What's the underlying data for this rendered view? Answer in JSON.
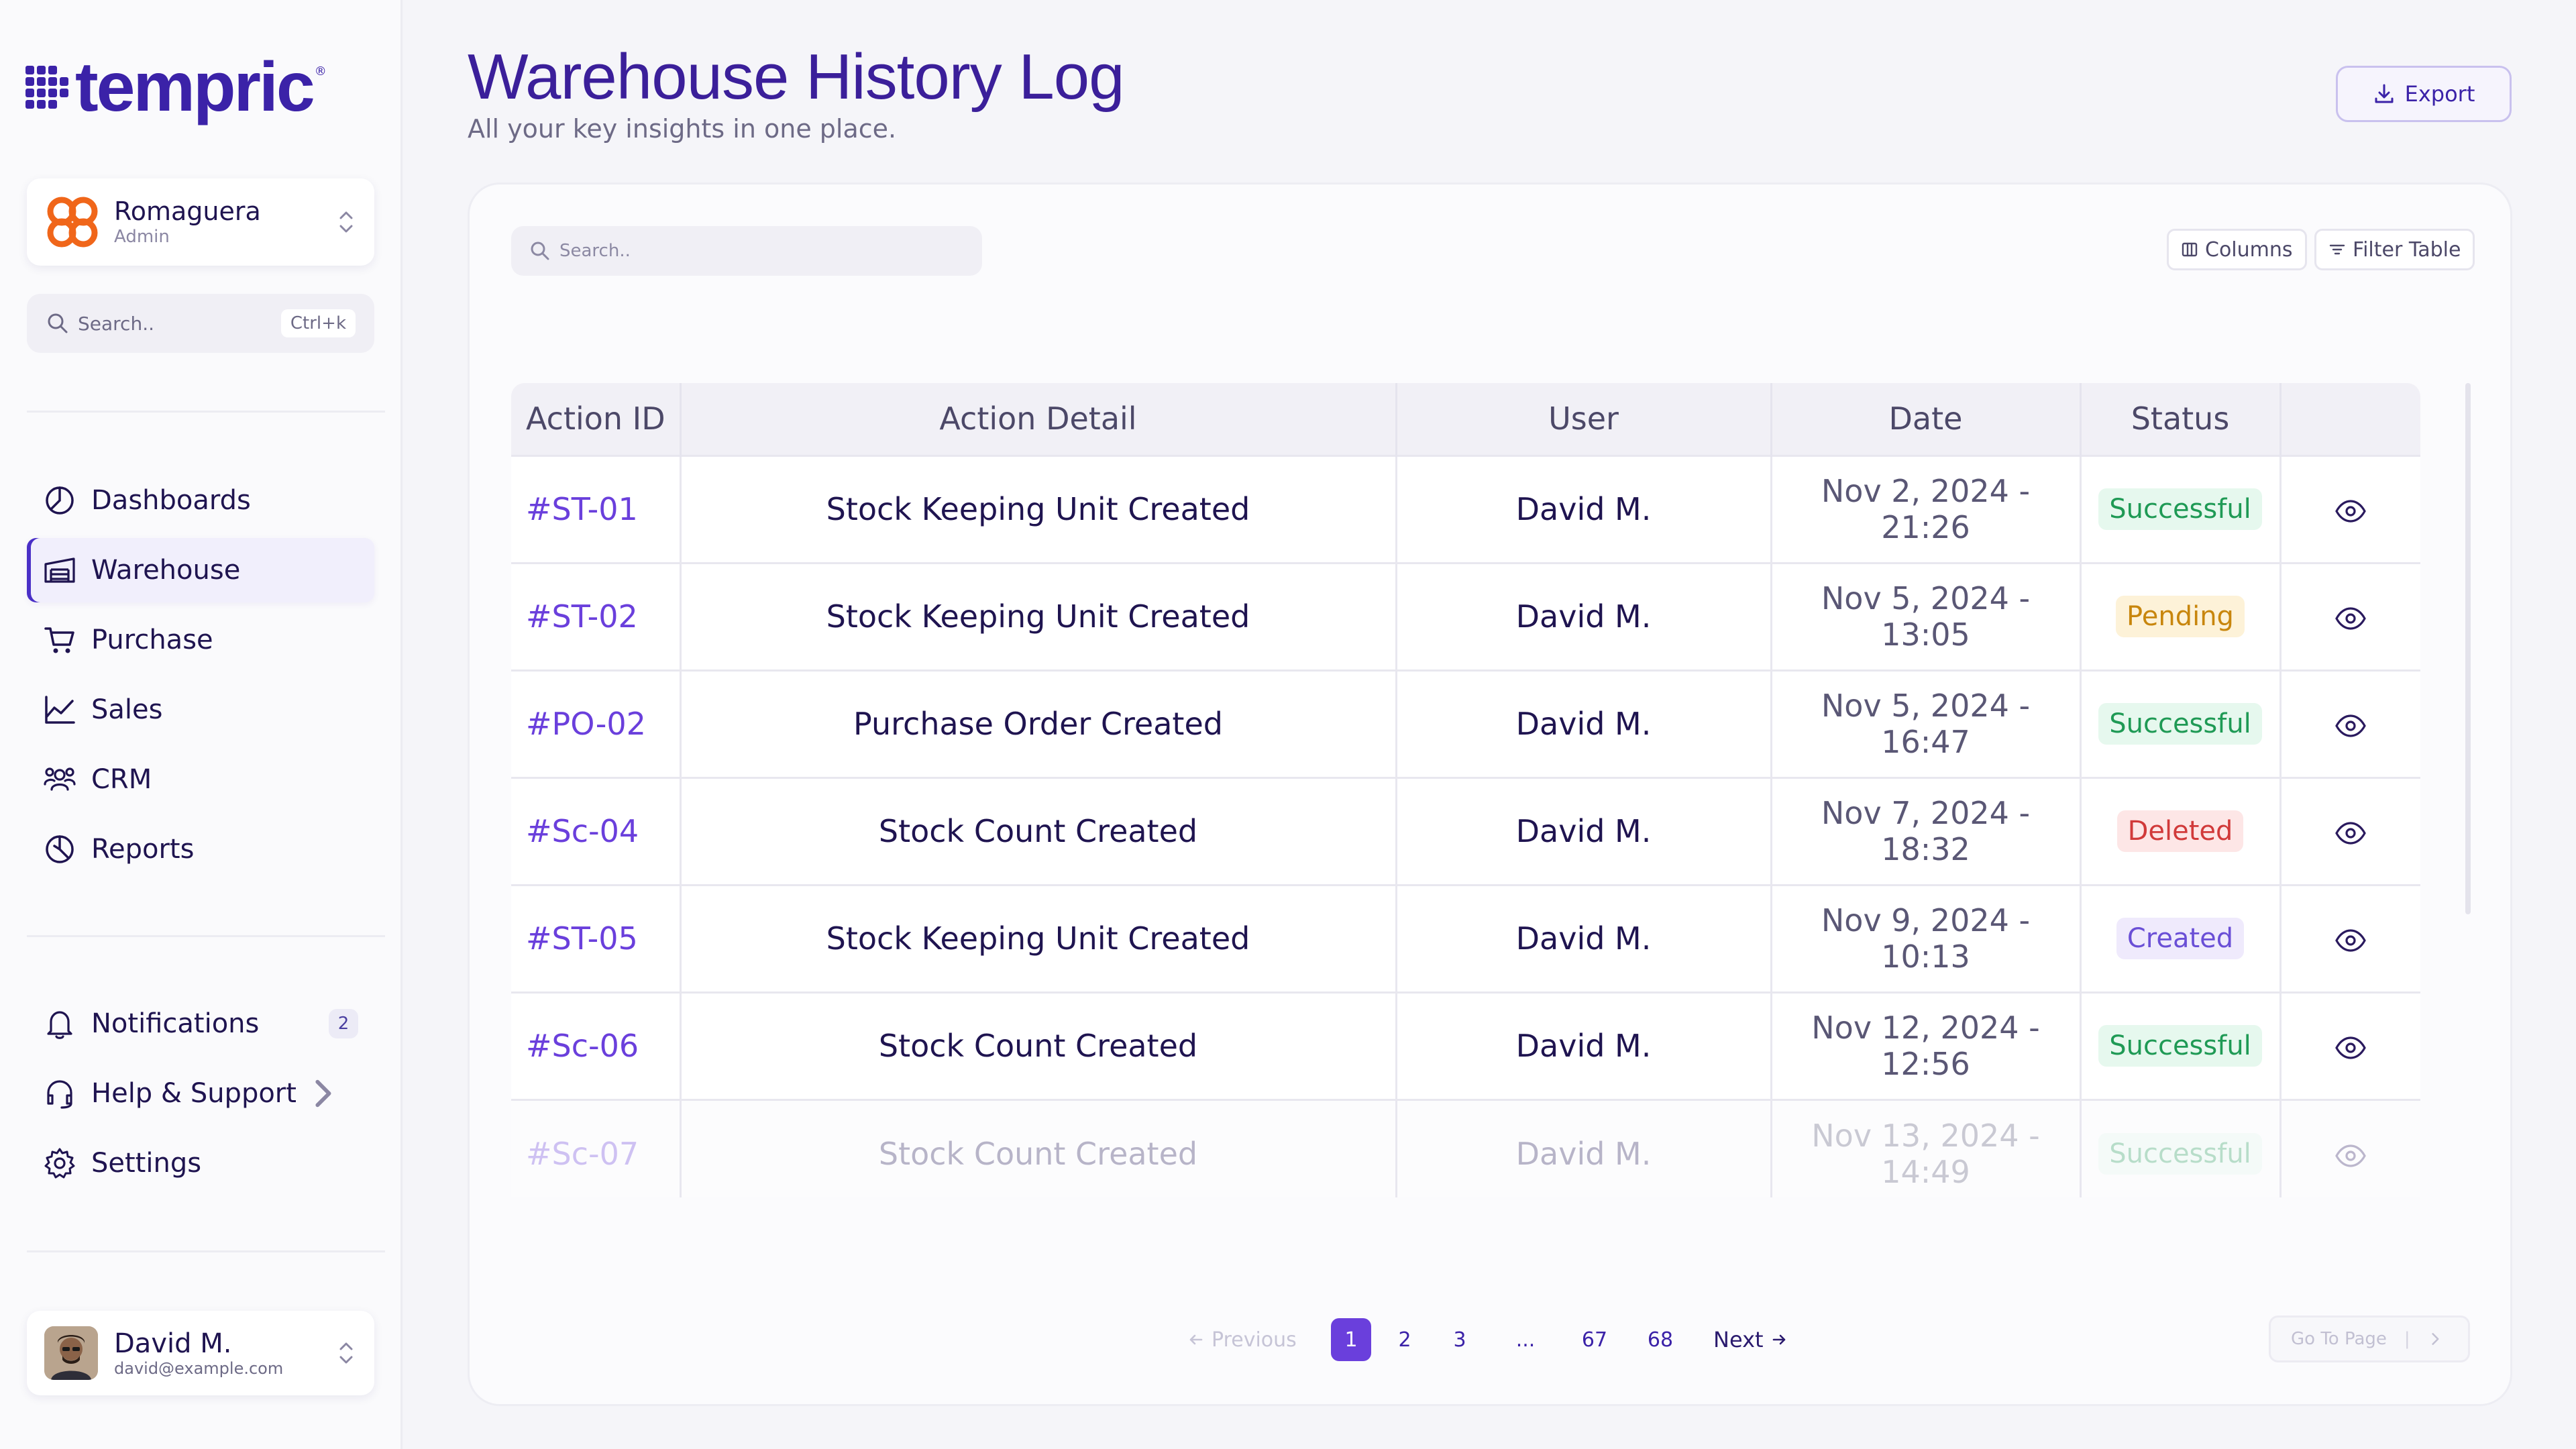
{
  "brand": {
    "name": "tempric",
    "mark": "®"
  },
  "org": {
    "name": "Romaguera",
    "role": "Admin"
  },
  "sidebar_search": {
    "placeholder": "Search..",
    "shortcut": "Ctrl+k"
  },
  "nav": {
    "items": [
      {
        "label": "Dashboards",
        "icon": "chart-pie-icon",
        "active": false
      },
      {
        "label": "Warehouse",
        "icon": "warehouse-icon",
        "active": true
      },
      {
        "label": "Purchase",
        "icon": "cart-icon",
        "active": false
      },
      {
        "label": "Sales",
        "icon": "line-chart-icon",
        "active": false
      },
      {
        "label": "CRM",
        "icon": "users-icon",
        "active": false
      },
      {
        "label": "Reports",
        "icon": "report-icon",
        "active": false
      }
    ],
    "secondary": [
      {
        "label": "Notifications",
        "icon": "bell-icon",
        "badge": "2"
      },
      {
        "label": "Help & Support",
        "icon": "headset-icon"
      },
      {
        "label": "Settings",
        "icon": "gear-icon"
      }
    ]
  },
  "user": {
    "name": "David M.",
    "email": "david@example.com"
  },
  "header": {
    "title": "Warehouse History Log",
    "subtitle": "All your key insights in one place.",
    "export_label": "Export"
  },
  "table_tools": {
    "search_placeholder": "Search..",
    "columns_label": "Columns",
    "filter_label": "Filter Table"
  },
  "table": {
    "columns": [
      "Action ID",
      "Action Detail",
      "User",
      "Date",
      "Status",
      ""
    ],
    "rows": [
      {
        "id": "#ST-01",
        "detail": "Stock Keeping Unit Created",
        "user": "David M.",
        "date": "Nov 2, 2024 - 21:26",
        "status": "Successful",
        "status_type": "success"
      },
      {
        "id": "#ST-02",
        "detail": "Stock Keeping Unit Created",
        "user": "David M.",
        "date": "Nov 5, 2024 - 13:05",
        "status": "Pending",
        "status_type": "pending"
      },
      {
        "id": "#PO-02",
        "detail": "Purchase Order Created",
        "user": "David M.",
        "date": "Nov 5, 2024 - 16:47",
        "status": "Successful",
        "status_type": "success"
      },
      {
        "id": "#Sc-04",
        "detail": "Stock Count Created",
        "user": "David M.",
        "date": "Nov 7, 2024 - 18:32",
        "status": "Deleted",
        "status_type": "deleted"
      },
      {
        "id": "#ST-05",
        "detail": "Stock Keeping Unit Created",
        "user": "David M.",
        "date": "Nov 9, 2024 - 10:13",
        "status": "Created",
        "status_type": "created"
      },
      {
        "id": "#Sc-06",
        "detail": "Stock Count Created",
        "user": "David M.",
        "date": "Nov 12, 2024 - 12:56",
        "status": "Successful",
        "status_type": "success"
      },
      {
        "id": "#Sc-07",
        "detail": "Stock Count Created",
        "user": "David M.",
        "date": "Nov 13, 2024 - 14:49",
        "status": "Successful",
        "status_type": "success"
      }
    ]
  },
  "pagination": {
    "prev_label": "Previous",
    "pages": [
      "1",
      "2",
      "3",
      "...",
      "67",
      "68"
    ],
    "current": "1",
    "next_label": "Next",
    "goto_label": "Go To Page"
  },
  "colors": {
    "accent": "#6a3fdc",
    "brand": "#3b22a8",
    "success": "#1f9a55",
    "pending": "#c8860d",
    "deleted": "#d13a3a",
    "created": "#6a4fd6"
  }
}
